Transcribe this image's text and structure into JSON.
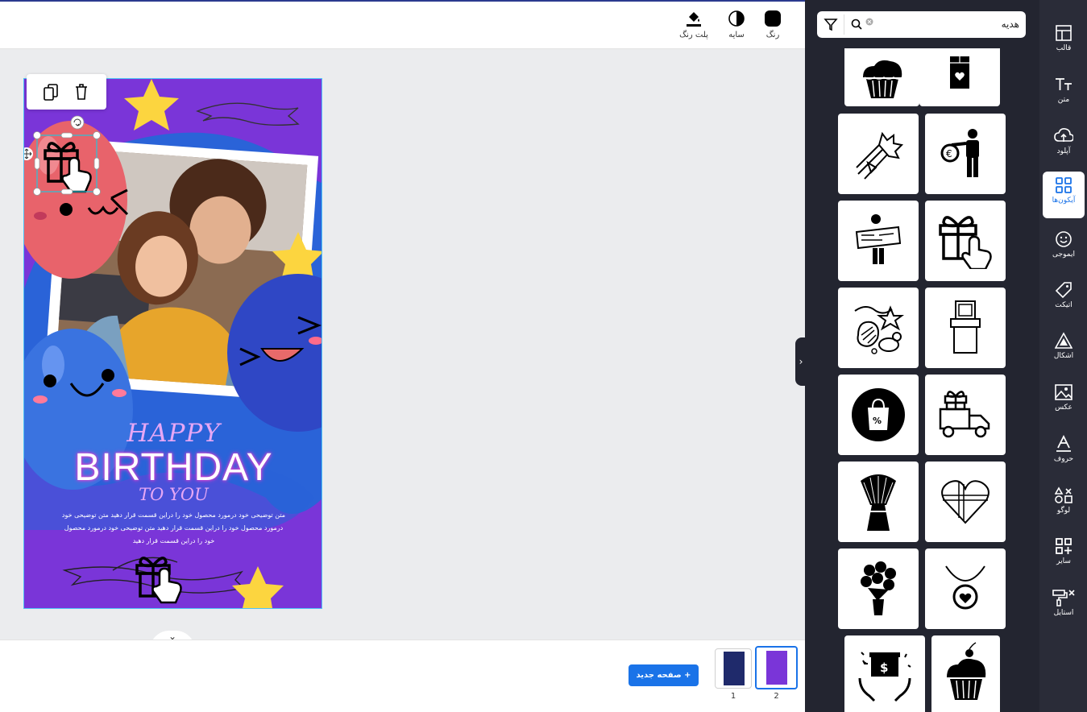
{
  "toolbar": {
    "color_label": "رنگ",
    "shadow_label": "سایه",
    "palette_label": "پلت رنگ"
  },
  "poster": {
    "happy": "HAPPY",
    "birthday": "BIRTHDAY",
    "to_you": "TO YOU",
    "body_lines": [
      "متن توضیحی خود درمورد محصول خود را دراین قسمت قرار دهید متن توضیحی خود",
      "درمورد محصول خود را دراین قسمت قرار دهید متن توضیحی خود درمورد محصول",
      "خود را دراین قسمت قرار دهید"
    ]
  },
  "bottom": {
    "new_page_label": "صفحه جدید",
    "pages": [
      {
        "number": "1",
        "selected": false
      },
      {
        "number": "2",
        "selected": true
      }
    ]
  },
  "panel": {
    "search_value": "هدیه",
    "icons": [
      "cupcake-icon",
      "chocolate-bar-icon",
      "flower-bouquet-icon",
      "person-euro-bag-icon",
      "person-check-board-icon",
      "gift-hand-tap-icon",
      "party-confetti-icon",
      "gift-tower-icon",
      "shopping-bag-discount-icon",
      "delivery-truck-gift-icon",
      "flower-bouquet-filled-icon",
      "heart-gift-box-icon",
      "rose-bouquet-icon",
      "heart-necklace-icon",
      "hands-gift-money-icon",
      "cupcake-cherry-icon"
    ]
  },
  "sidebar": {
    "items": [
      {
        "label": "قالب",
        "icon": "template-icon"
      },
      {
        "label": "متن",
        "icon": "text-icon"
      },
      {
        "label": "آپلود",
        "icon": "upload-icon"
      },
      {
        "label": "آیکون‌ها",
        "icon": "icons-grid-icon",
        "active": true
      },
      {
        "label": "ایموجی",
        "icon": "emoji-icon"
      },
      {
        "label": "اتیکت",
        "icon": "tag-icon"
      },
      {
        "label": "اشکال",
        "icon": "shapes-icon"
      },
      {
        "label": "عکس",
        "icon": "image-icon"
      },
      {
        "label": "حروف",
        "icon": "letter-icon"
      },
      {
        "label": "لوگو",
        "icon": "logo-icon"
      },
      {
        "label": "سایر",
        "icon": "more-grid-icon"
      },
      {
        "label": "استایل",
        "icon": "style-roller-icon"
      }
    ]
  },
  "colors": {
    "accent": "#1a73e8",
    "panel_bg": "#232530",
    "sidebar_bg": "#2a2c38",
    "poster_bg": "#7a35d8"
  }
}
